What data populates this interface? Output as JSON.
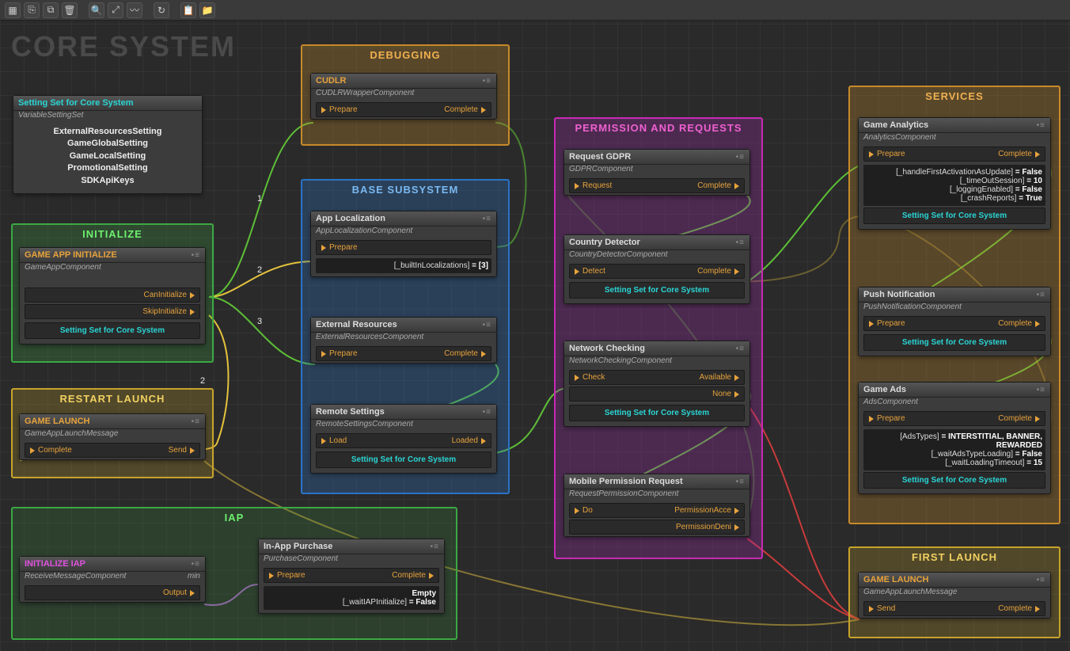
{
  "watermark": "CORE SYSTEM",
  "toolbar": {
    "items": [
      "new",
      "open",
      "duplicate",
      "delete",
      "search",
      "fit",
      "flow",
      "refresh",
      "clipboard",
      "folder"
    ]
  },
  "settingSetNode": {
    "title": "Setting Set for Core System",
    "subtitle": "VariableSettingSet",
    "items": [
      "ExternalResourcesSetting",
      "GameGlobalSetting",
      "GameLocalSetting",
      "PromotionalSetting",
      "SDKApiKeys"
    ]
  },
  "groups": {
    "initialize": {
      "title": "INITIALIZE"
    },
    "restart": {
      "title": "RESTART LAUNCH"
    },
    "iap": {
      "title": "IAP"
    },
    "debugging": {
      "title": "DEBUGGING"
    },
    "base": {
      "title": "BASE SUBSYSTEM"
    },
    "permission": {
      "title": "PERMISSION AND REQUESTS"
    },
    "services": {
      "title": "SERVICES"
    },
    "first": {
      "title": "FIRST LAUNCH"
    }
  },
  "nodes": {
    "gameAppInit": {
      "title": "GAME APP INITIALIZE",
      "subtitle": "GameAppComponent",
      "out1": "CanInitialize",
      "out2": "SkipInitialize",
      "link": "Setting Set for Core System"
    },
    "gameLaunchRestart": {
      "title": "GAME LAUNCH",
      "subtitle": "GameAppLaunchMessage",
      "in1": "Complete",
      "out1": "Send"
    },
    "initIAP": {
      "title": "INITIALIZE IAP",
      "subtitle": "ReceiveMessageComponent",
      "tag": "min",
      "out1": "Output"
    },
    "inAppPurchase": {
      "title": "In-App Purchase",
      "subtitle": "PurchaseComponent",
      "in1": "Prepare",
      "out1": "Complete",
      "p1": "Empty",
      "p2k": "[_waitIAPInitialize]",
      "p2v": "= False"
    },
    "cudlr": {
      "title": "CUDLR",
      "subtitle": "CUDLRWrapperComponent",
      "in1": "Prepare",
      "out1": "Complete"
    },
    "appLoc": {
      "title": "App Localization",
      "subtitle": "AppLocalizationComponent",
      "in1": "Prepare",
      "p1k": "[_builtInLocalizations]",
      "p1v": "= [3]"
    },
    "extRes": {
      "title": "External Resources",
      "subtitle": "ExternalResourcesComponent",
      "in1": "Prepare",
      "out1": "Complete"
    },
    "remoteSettings": {
      "title": "Remote Settings",
      "subtitle": "RemoteSettingsComponent",
      "in1": "Load",
      "out1": "Loaded",
      "link": "Setting Set for Core System"
    },
    "requestGDPR": {
      "title": "Request GDPR",
      "subtitle": "GDPRComponent",
      "in1": "Request",
      "out1": "Complete"
    },
    "countryDetector": {
      "title": "Country Detector",
      "subtitle": "CountryDetectorComponent",
      "in1": "Detect",
      "out1": "Complete",
      "link": "Setting Set for Core System"
    },
    "networkCheck": {
      "title": "Network Checking",
      "subtitle": "NetworkCheckingComponent",
      "in1": "Check",
      "out1": "Available",
      "out2": "None",
      "link": "Setting Set for Core System"
    },
    "mobilePerm": {
      "title": "Mobile Permission Request",
      "subtitle": "RequestPermissionComponent",
      "in1": "Do",
      "out1": "PermissionAcce",
      "out2": "PermissionDeni"
    },
    "gameAnalytics": {
      "title": "Game Analytics",
      "subtitle": "AnalyticsComponent",
      "in1": "Prepare",
      "out1": "Complete",
      "p1k": "[_handleFirstActivationAsUpdate]",
      "p1v": "= False",
      "p2k": "[_timeOutSession]",
      "p2v": "= 10",
      "p3k": "[_loggingEnabled]",
      "p3v": "= False",
      "p4k": "[_crashReports]",
      "p4v": "= True",
      "link": "Setting Set for Core System"
    },
    "pushNotif": {
      "title": "Push Notification",
      "subtitle": "PushNotificationComponent",
      "in1": "Prepare",
      "out1": "Complete",
      "link": "Setting Set for Core System"
    },
    "gameAds": {
      "title": "Game Ads",
      "subtitle": "AdsComponent",
      "in1": "Prepare",
      "out1": "Complete",
      "p1k": "[AdsTypes]",
      "p1v": "= INTERSTITIAL, BANNER, REWARDED",
      "p2k": "[_waitAdsTypeLoading]",
      "p2v": "= False",
      "p3k": "[_waitLoadingTimeout]",
      "p3v": "= 15",
      "link": "Setting Set for Core System"
    },
    "gameLaunchFirst": {
      "title": "GAME LAUNCH",
      "subtitle": "GameAppLaunchMessage",
      "in1": "Send",
      "out1": "Complete"
    }
  },
  "edgeLabels": {
    "l1": "1",
    "l2": "2",
    "l3": "3",
    "l2b": "2"
  }
}
